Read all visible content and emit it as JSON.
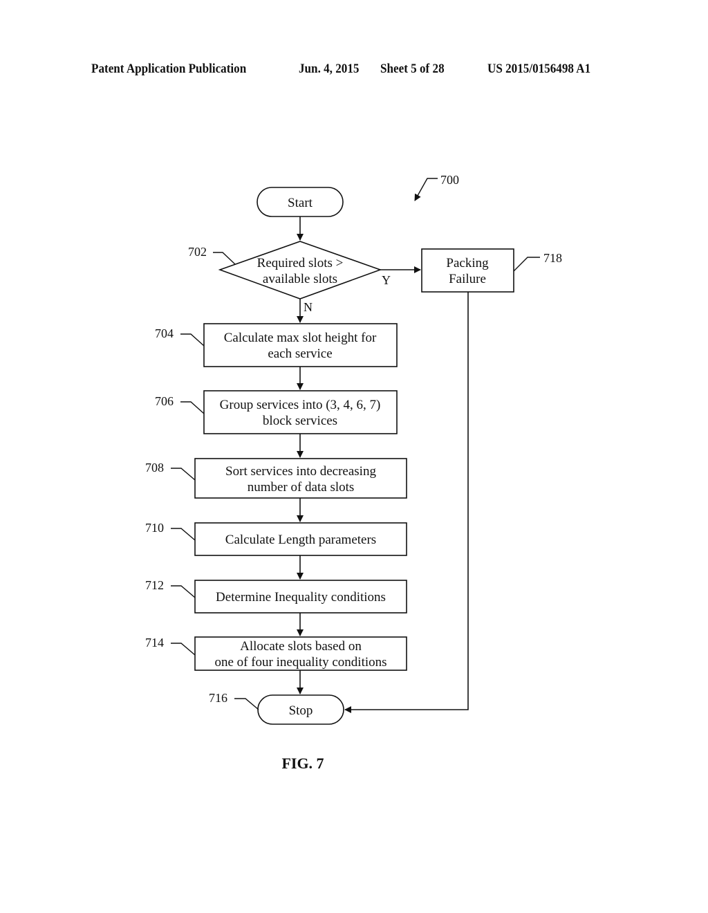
{
  "header": {
    "publication": "Patent Application Publication",
    "date": "Jun. 4, 2015",
    "sheet": "Sheet 5 of 28",
    "number": "US 2015/0156498 A1"
  },
  "figure": {
    "ref": "700",
    "caption": "FIG. 7"
  },
  "nodes": {
    "start": {
      "label": "Start"
    },
    "n702": {
      "ref": "702",
      "lines": [
        "Required slots >",
        "available slots"
      ],
      "yes_label": "Y",
      "no_label": "N"
    },
    "n704": {
      "ref": "704",
      "lines": [
        "Calculate max slot height for",
        "each service"
      ]
    },
    "n706": {
      "ref": "706",
      "lines": [
        "Group services into (3, 4, 6, 7)",
        "block services"
      ]
    },
    "n708": {
      "ref": "708",
      "lines": [
        "Sort services into decreasing",
        "number of data slots"
      ]
    },
    "n710": {
      "ref": "710",
      "lines": [
        "Calculate Length parameters"
      ]
    },
    "n712": {
      "ref": "712",
      "lines": [
        "Determine Inequality conditions"
      ]
    },
    "n714": {
      "ref": "714",
      "lines": [
        "Allocate slots based on",
        "one of four inequality conditions"
      ]
    },
    "n716": {
      "ref": "716",
      "label": "Stop"
    },
    "n718": {
      "ref": "718",
      "lines": [
        "Packing",
        "Failure"
      ]
    }
  }
}
